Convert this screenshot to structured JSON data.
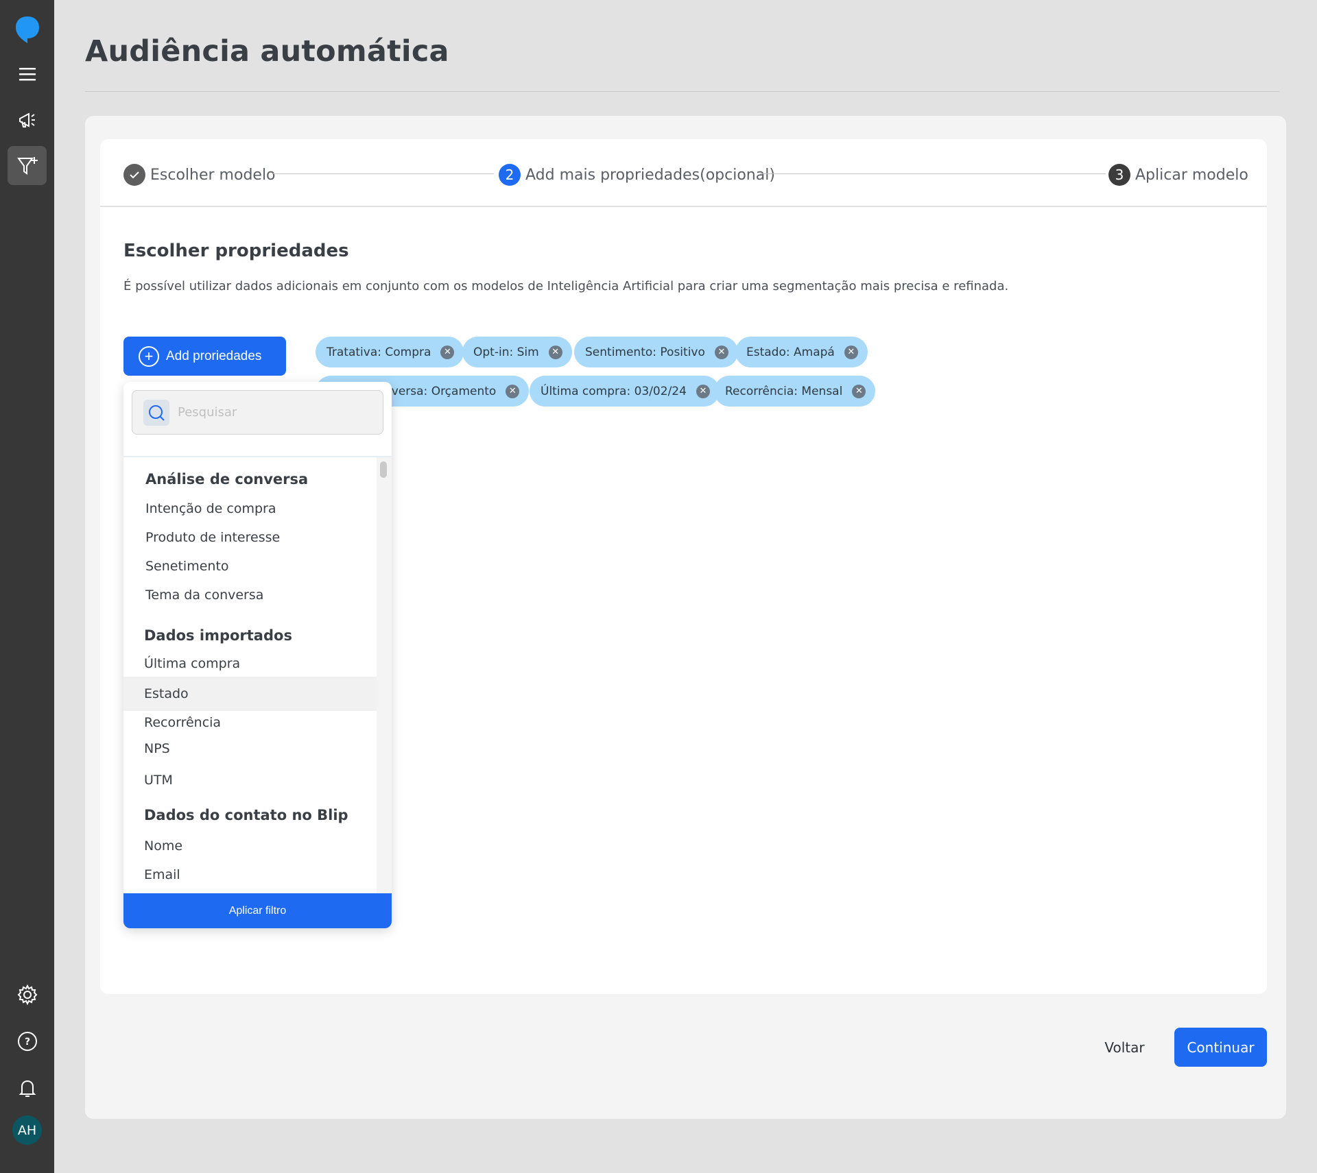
{
  "sidebar": {
    "icons": [
      "blip-logo-icon",
      "menu-icon",
      "megaphone-icon",
      "filter-add-icon",
      "gear-icon",
      "help-icon",
      "bell-icon"
    ],
    "avatar_initials": "AH",
    "accent_color": "#1e6bf1"
  },
  "page": {
    "title": "Audiência automática"
  },
  "stepper": {
    "steps": [
      {
        "index": "✓",
        "label": "Escolher modelo",
        "state": "done"
      },
      {
        "index": "2",
        "label": "Add mais propriedades(opcional)",
        "state": "current"
      },
      {
        "index": "3",
        "label": "Aplicar modelo",
        "state": "pending"
      }
    ]
  },
  "section": {
    "title": "Escolher propriedades",
    "description": "É possível utilizar dados adicionais em conjunto com os modelos de Inteligência Artificial para criar uma segmentação mais precisa e refinada."
  },
  "add_button": {
    "label": "Add proriedades"
  },
  "chips": [
    "Tratativa: Compra",
    "Opt-in: Sim",
    "Sentimento: Positivo",
    "Estado: Amapá",
    "nversa: Orçamento",
    "Última compra: 03/02/24",
    "Recorrência: Mensal"
  ],
  "dropdown": {
    "search_placeholder": "Pesquisar",
    "groups": [
      {
        "title": "Análise de conversa",
        "items": [
          "Intenção de compra",
          "Produto de interesse",
          "Senetimento",
          "Tema da conversa"
        ]
      },
      {
        "title": "Dados importados",
        "items": [
          "Última compra",
          "Estado",
          "Recorrência",
          "NPS",
          "UTM"
        ]
      },
      {
        "title": "Dados do contato no Blip",
        "items": [
          "Nome",
          "Email"
        ]
      }
    ],
    "apply_label": "Aplicar filtro"
  },
  "footer": {
    "back_label": "Voltar",
    "continue_label": "Continuar"
  }
}
